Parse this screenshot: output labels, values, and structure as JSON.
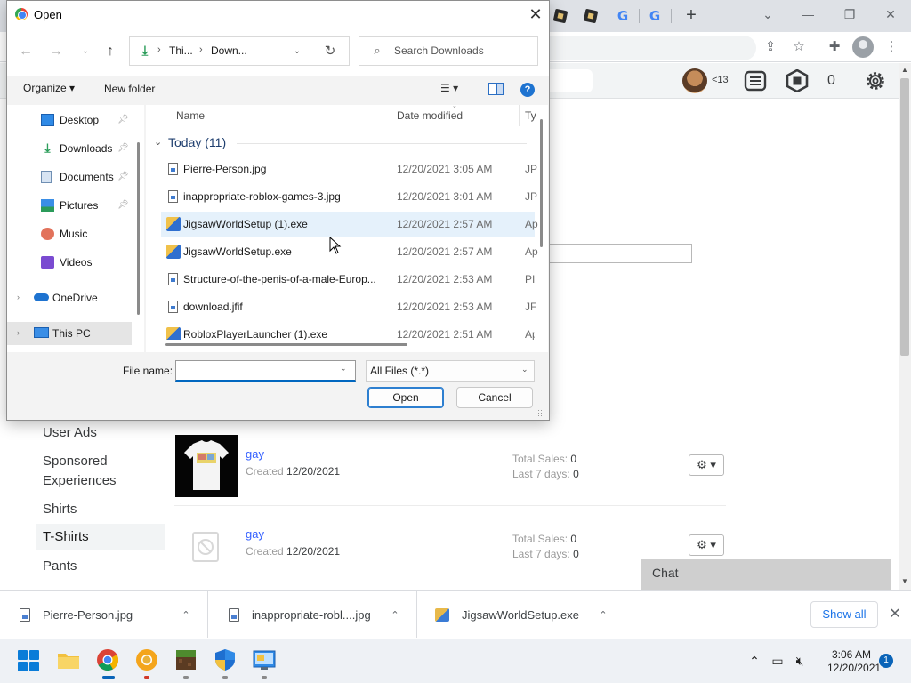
{
  "dialog": {
    "title": "Open",
    "close_glyph": "✕",
    "address": {
      "crumbs": [
        "Thi...",
        "Down..."
      ],
      "separator": "›"
    },
    "search_placeholder": "Search Downloads",
    "toolbar": {
      "organize_label": "Organize ▾",
      "new_folder_label": "New folder",
      "view_label": "☰ ▾",
      "help_label": "?"
    },
    "nav_pane": {
      "items": [
        {
          "label": "Desktop",
          "icon": "desktop-icon",
          "pinned": true
        },
        {
          "label": "Downloads",
          "icon": "downloads-icon",
          "pinned": true
        },
        {
          "label": "Documents",
          "icon": "documents-icon",
          "pinned": true
        },
        {
          "label": "Pictures",
          "icon": "pictures-icon",
          "pinned": true
        },
        {
          "label": "Music",
          "icon": "music-icon",
          "pinned": false
        },
        {
          "label": "Videos",
          "icon": "videos-icon",
          "pinned": false
        },
        {
          "label": "OneDrive",
          "icon": "onedrive-icon",
          "pinned": false
        },
        {
          "label": "This PC",
          "icon": "this-pc-icon",
          "pinned": false,
          "selected": true
        }
      ]
    },
    "file_list": {
      "columns": [
        "Name",
        "Date modified",
        "Ty"
      ],
      "group_header": "Today (11)",
      "files": [
        {
          "name": "Pierre-Person.jpg",
          "date": "12/20/2021 3:05 AM",
          "type": "JP",
          "kind": "image"
        },
        {
          "name": "inappropriate-roblox-games-3.jpg",
          "date": "12/20/2021 3:01 AM",
          "type": "JP",
          "kind": "image"
        },
        {
          "name": "JigsawWorldSetup (1).exe",
          "date": "12/20/2021 2:57 AM",
          "type": "Ap",
          "kind": "exe",
          "hover": true
        },
        {
          "name": "JigsawWorldSetup.exe",
          "date": "12/20/2021 2:57 AM",
          "type": "Ap",
          "kind": "exe"
        },
        {
          "name": "Structure-of-the-penis-of-a-male-Europ...",
          "date": "12/20/2021 2:53 AM",
          "type": "PI",
          "kind": "image"
        },
        {
          "name": "download.jfif",
          "date": "12/20/2021 2:53 AM",
          "type": "JF",
          "kind": "image"
        },
        {
          "name": "RobloxPlayerLauncher (1).exe",
          "date": "12/20/2021 2:51 AM",
          "type": "Ap",
          "kind": "exe"
        }
      ]
    },
    "file_name_label": "File name:",
    "file_name_value": "",
    "file_type_value": "All Files (*.*)",
    "open_label": "Open",
    "cancel_label": "Cancel"
  },
  "roblox": {
    "age_label": "<13",
    "robux_count": "0",
    "left_nav": [
      "User Ads",
      "Sponsored",
      "Experiences",
      "Shirts",
      "T-Shirts",
      "Pants"
    ],
    "active_nav": "T-Shirts",
    "assets": [
      {
        "name": "gay",
        "created_label": "Created",
        "created": "12/20/2021",
        "sales_label": "Total Sales:",
        "sales": "0",
        "last7_label": "Last 7 days:",
        "last7": "0",
        "has_thumbnail": true
      },
      {
        "name": "gay",
        "created_label": "Created",
        "created": "12/20/2021",
        "sales_label": "Total Sales:",
        "sales": "0",
        "last7_label": "Last 7 days:",
        "last7": "0",
        "has_thumbnail": false
      }
    ],
    "gear_label": "⚙ ▾",
    "chat_label": "Chat"
  },
  "downloads": {
    "items": [
      "Pierre-Person.jpg",
      "inappropriate-robl....jpg",
      "JigsawWorldSetup.exe"
    ],
    "show_all_label": "Show all",
    "close_glyph": "✕"
  },
  "taskbar": {
    "time": "3:06 AM",
    "date": "12/20/2021",
    "notification_count": "1"
  }
}
